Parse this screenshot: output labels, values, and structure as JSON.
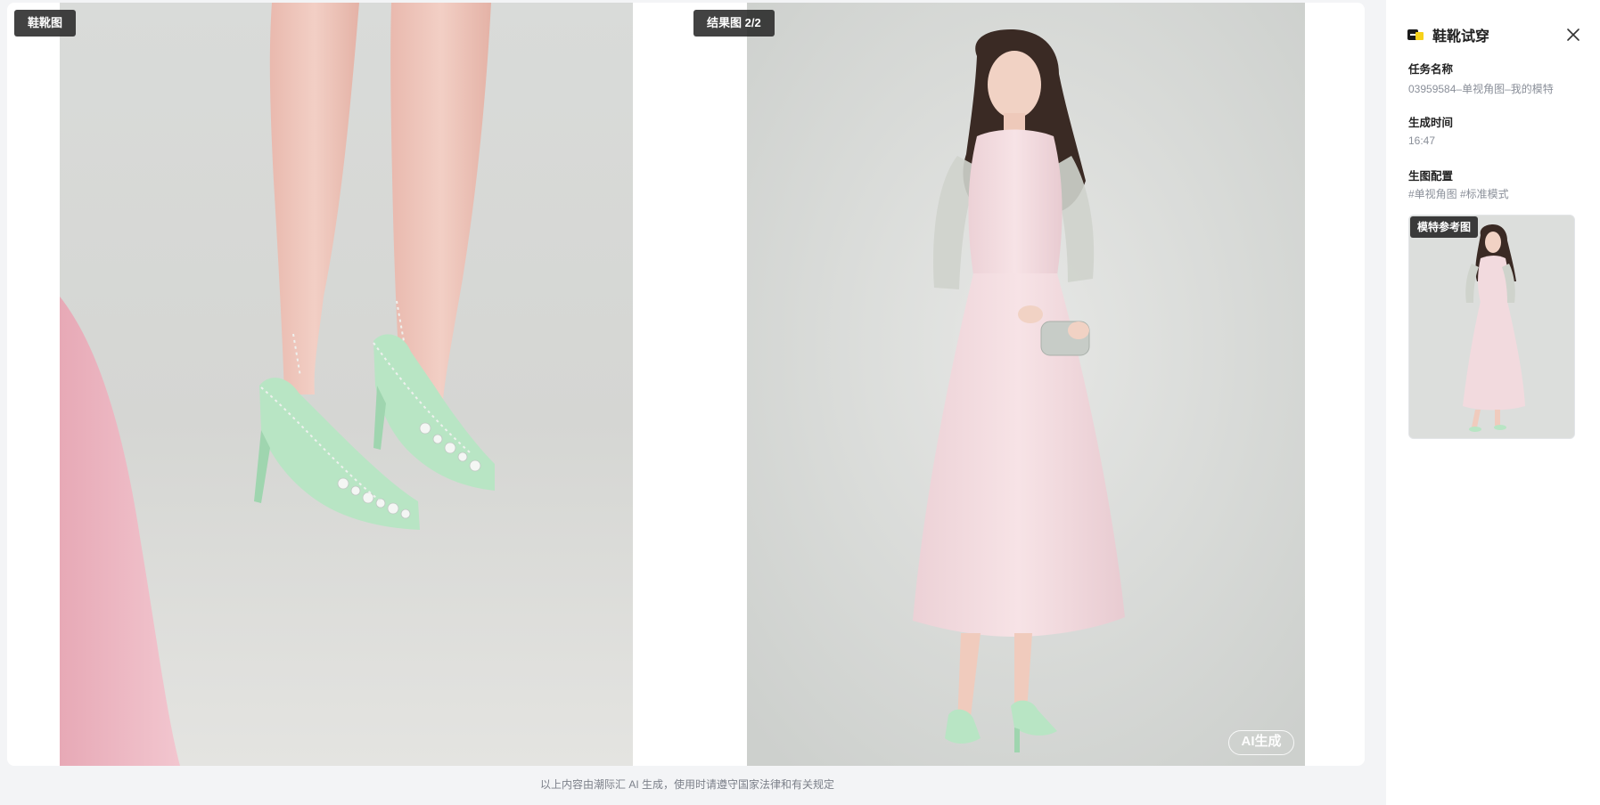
{
  "viewer": {
    "shoe_tag": "鞋靴图",
    "result_tag": "结果图 2/2",
    "ai_badge": "AI生成"
  },
  "footer": {
    "note": "以上内容由潮际汇 AI 生成，使用时请遵守国家法律和有关规定"
  },
  "side_panel": {
    "title": "鞋靴试穿",
    "task_name_label": "任务名称",
    "task_name_value": "03959584–单视角图–我的模特",
    "time_label": "生成时间",
    "time_value": "16:47",
    "config_label": "生图配置",
    "config_value": "#单视角图 #标准模式",
    "ref_tag": "模特参考图"
  },
  "colors": {
    "tag_bg": "#2a2a2a",
    "shoe_green": "#b9e6c6",
    "dress_pink": "#f3d9df",
    "backdrop_gray": "#dcdedc"
  },
  "icons": [
    "app-logo-icon",
    "close-icon"
  ]
}
